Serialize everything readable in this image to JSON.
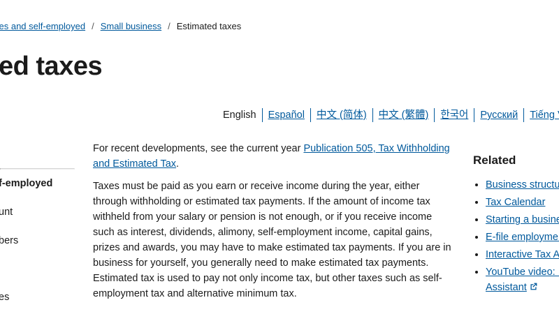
{
  "breadcrumb": {
    "items": [
      "ses and self-employed",
      "Small business"
    ],
    "current": "Estimated taxes"
  },
  "page_title": "ed taxes",
  "languages": [
    "English",
    "Español",
    "中文 (简体)",
    "中文 (繁體)",
    "한국어",
    "Русский",
    "Tiếng Vi"
  ],
  "sidebar": {
    "items": [
      "f-employed",
      "unt",
      "bers",
      "es"
    ]
  },
  "main": {
    "intro_prefix": "For recent developments, see the current year ",
    "intro_link": "Publication 505, Tax Withholding and Estimated Tax",
    "intro_suffix": ".",
    "paragraph": "Taxes must be paid as you earn or receive income during the year, either through withholding or estimated tax payments. If the amount of income tax withheld from your salary or pension is not enough, or if you receive income such as interest, dividends, alimony, self-employment income, capital gains, prizes and awards, you may have to make estimated tax payments. If you are in business for yourself, you generally need to make estimated tax payments. Estimated tax is used to pay not only income tax, but other taxes such as self-employment tax and alternative minimum tax."
  },
  "related": {
    "heading": "Related",
    "links": [
      "Business structur",
      "Tax Calendar",
      "Starting a busine",
      "E-file employmer",
      "Interactive Tax As",
      "YouTube video: In"
    ],
    "last_link_continuation": "Assistant",
    "external_icon": "external-link-icon"
  }
}
